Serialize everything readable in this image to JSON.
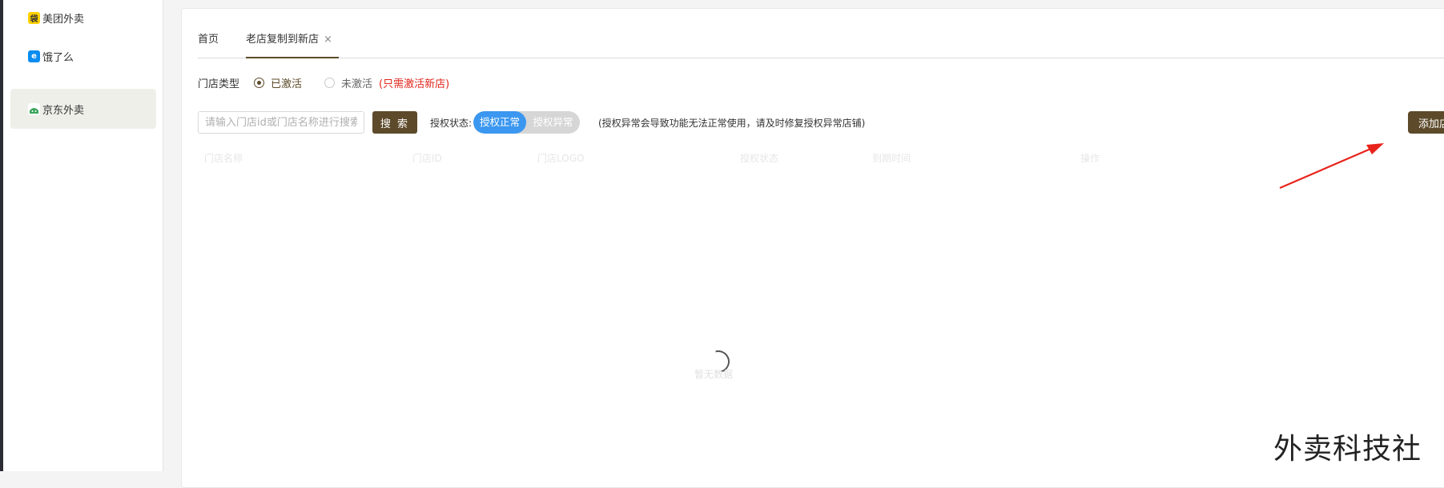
{
  "sidebar": {
    "items": [
      {
        "label": "美团外卖",
        "icon": "meituan-icon",
        "active": false
      },
      {
        "label": "饿了么",
        "icon": "eleme-icon",
        "active": false
      },
      {
        "label": "京东外卖",
        "icon": "jd-icon",
        "active": true
      }
    ]
  },
  "tabs": {
    "home": "首页",
    "active": "老店复制到新店",
    "close": "×"
  },
  "store_type": {
    "label": "门店类型",
    "option_activated": "已激活",
    "option_inactive": "未激活",
    "note": "(只需激活新店)"
  },
  "toolbar": {
    "search_placeholder": "请输入门店id或门店名称进行搜索",
    "search_button": "搜 索",
    "auth_label": "授权状态:",
    "auth_normal": "授权正常",
    "auth_abnormal": "授权异常",
    "auth_note": "(授权异常会导致功能无法正常使用，请及时修复授权异常店铺)",
    "add_button": "添加店铺"
  },
  "table": {
    "headers": [
      "门店名称",
      "门店ID",
      "门店LOGO",
      "授权状态",
      "到期时间",
      "操作"
    ]
  },
  "empty_text": "暂无数据",
  "watermark": "外卖科技社",
  "colors": {
    "primary_brown": "#5c4a2a",
    "toggle_blue": "#3b97f0",
    "note_red": "#e1251b",
    "annotation_arrow": "#e8231b"
  }
}
